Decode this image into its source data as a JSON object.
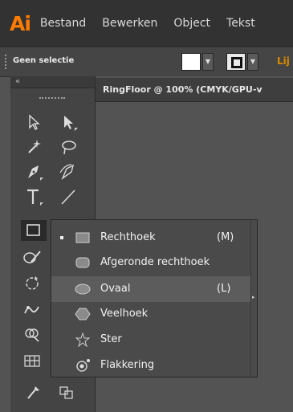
{
  "app": {
    "logo": "Ai"
  },
  "menu": [
    "Bestand",
    "Bewerken",
    "Object",
    "Tekst"
  ],
  "control_bar": {
    "selection": "Geen selectie",
    "extra": "Lij"
  },
  "document": {
    "tab_title": "RingFloor @ 100% (CMYK/GPU-v"
  },
  "toolbar": {
    "collapse": "«"
  },
  "flyout": {
    "items": [
      {
        "label": "Rechthoek",
        "shortcut": "(M)",
        "current": true,
        "icon": "rectangle-icon"
      },
      {
        "label": "Afgeronde rechthoek",
        "shortcut": "",
        "icon": "rounded-rectangle-icon"
      },
      {
        "label": "Ovaal",
        "shortcut": "(L)",
        "highlighted": true,
        "icon": "ellipse-icon"
      },
      {
        "label": "Veelhoek",
        "shortcut": "",
        "icon": "polygon-icon"
      },
      {
        "label": "Ster",
        "shortcut": "",
        "icon": "star-icon"
      },
      {
        "label": "Flakkering",
        "shortcut": "",
        "icon": "flare-icon"
      }
    ]
  },
  "colors": {
    "accent": "#ff7c00",
    "menubar": "#323232",
    "panel": "#444444",
    "canvas": "#535353"
  }
}
